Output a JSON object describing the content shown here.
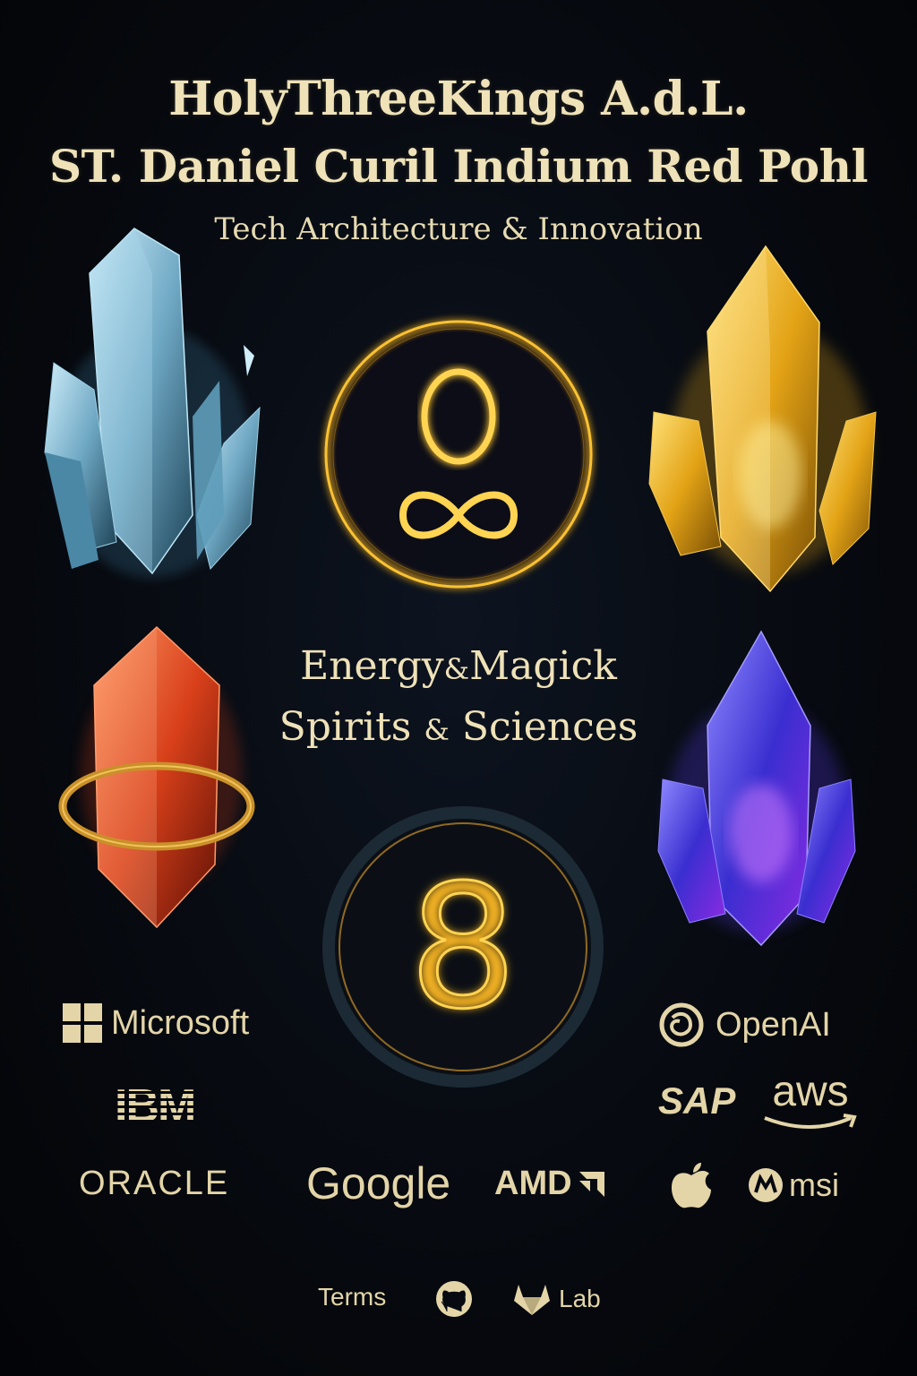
{
  "header": {
    "line1": "HolyThreeKings A.d.L.",
    "line2": "ST. Daniel Curil Indium Red Pohl",
    "tagline": "Tech Architecture & Innovation"
  },
  "center": {
    "energy": "Energy",
    "magick": "Magick",
    "spirits": "Spirits",
    "sciences": "Sciences",
    "amp": "&",
    "top_symbol": "O ∞",
    "bottom_symbol": "8"
  },
  "logos": {
    "microsoft": "Microsoft",
    "openai": "OpenAI",
    "ibm": "IBM",
    "sap": "SAP",
    "aws": "aws",
    "oracle": "ORACLE",
    "google": "Google",
    "amd": "AMD",
    "msi": "msi"
  },
  "footer": {
    "terms": "Terms",
    "lab": "Lab"
  },
  "icons": [
    "crystal-blue-icon",
    "crystal-gold-icon",
    "crystal-red-icon",
    "crystal-violet-icon",
    "microsoft-logo-icon",
    "openai-logo-icon",
    "aws-smile-icon",
    "amd-arrow-icon",
    "apple-logo-icon",
    "msi-logo-icon",
    "github-icon",
    "gitlab-icon"
  ],
  "colors": {
    "gold": "#f5b321",
    "text": "#e9ddb4",
    "background": "#05070c"
  }
}
